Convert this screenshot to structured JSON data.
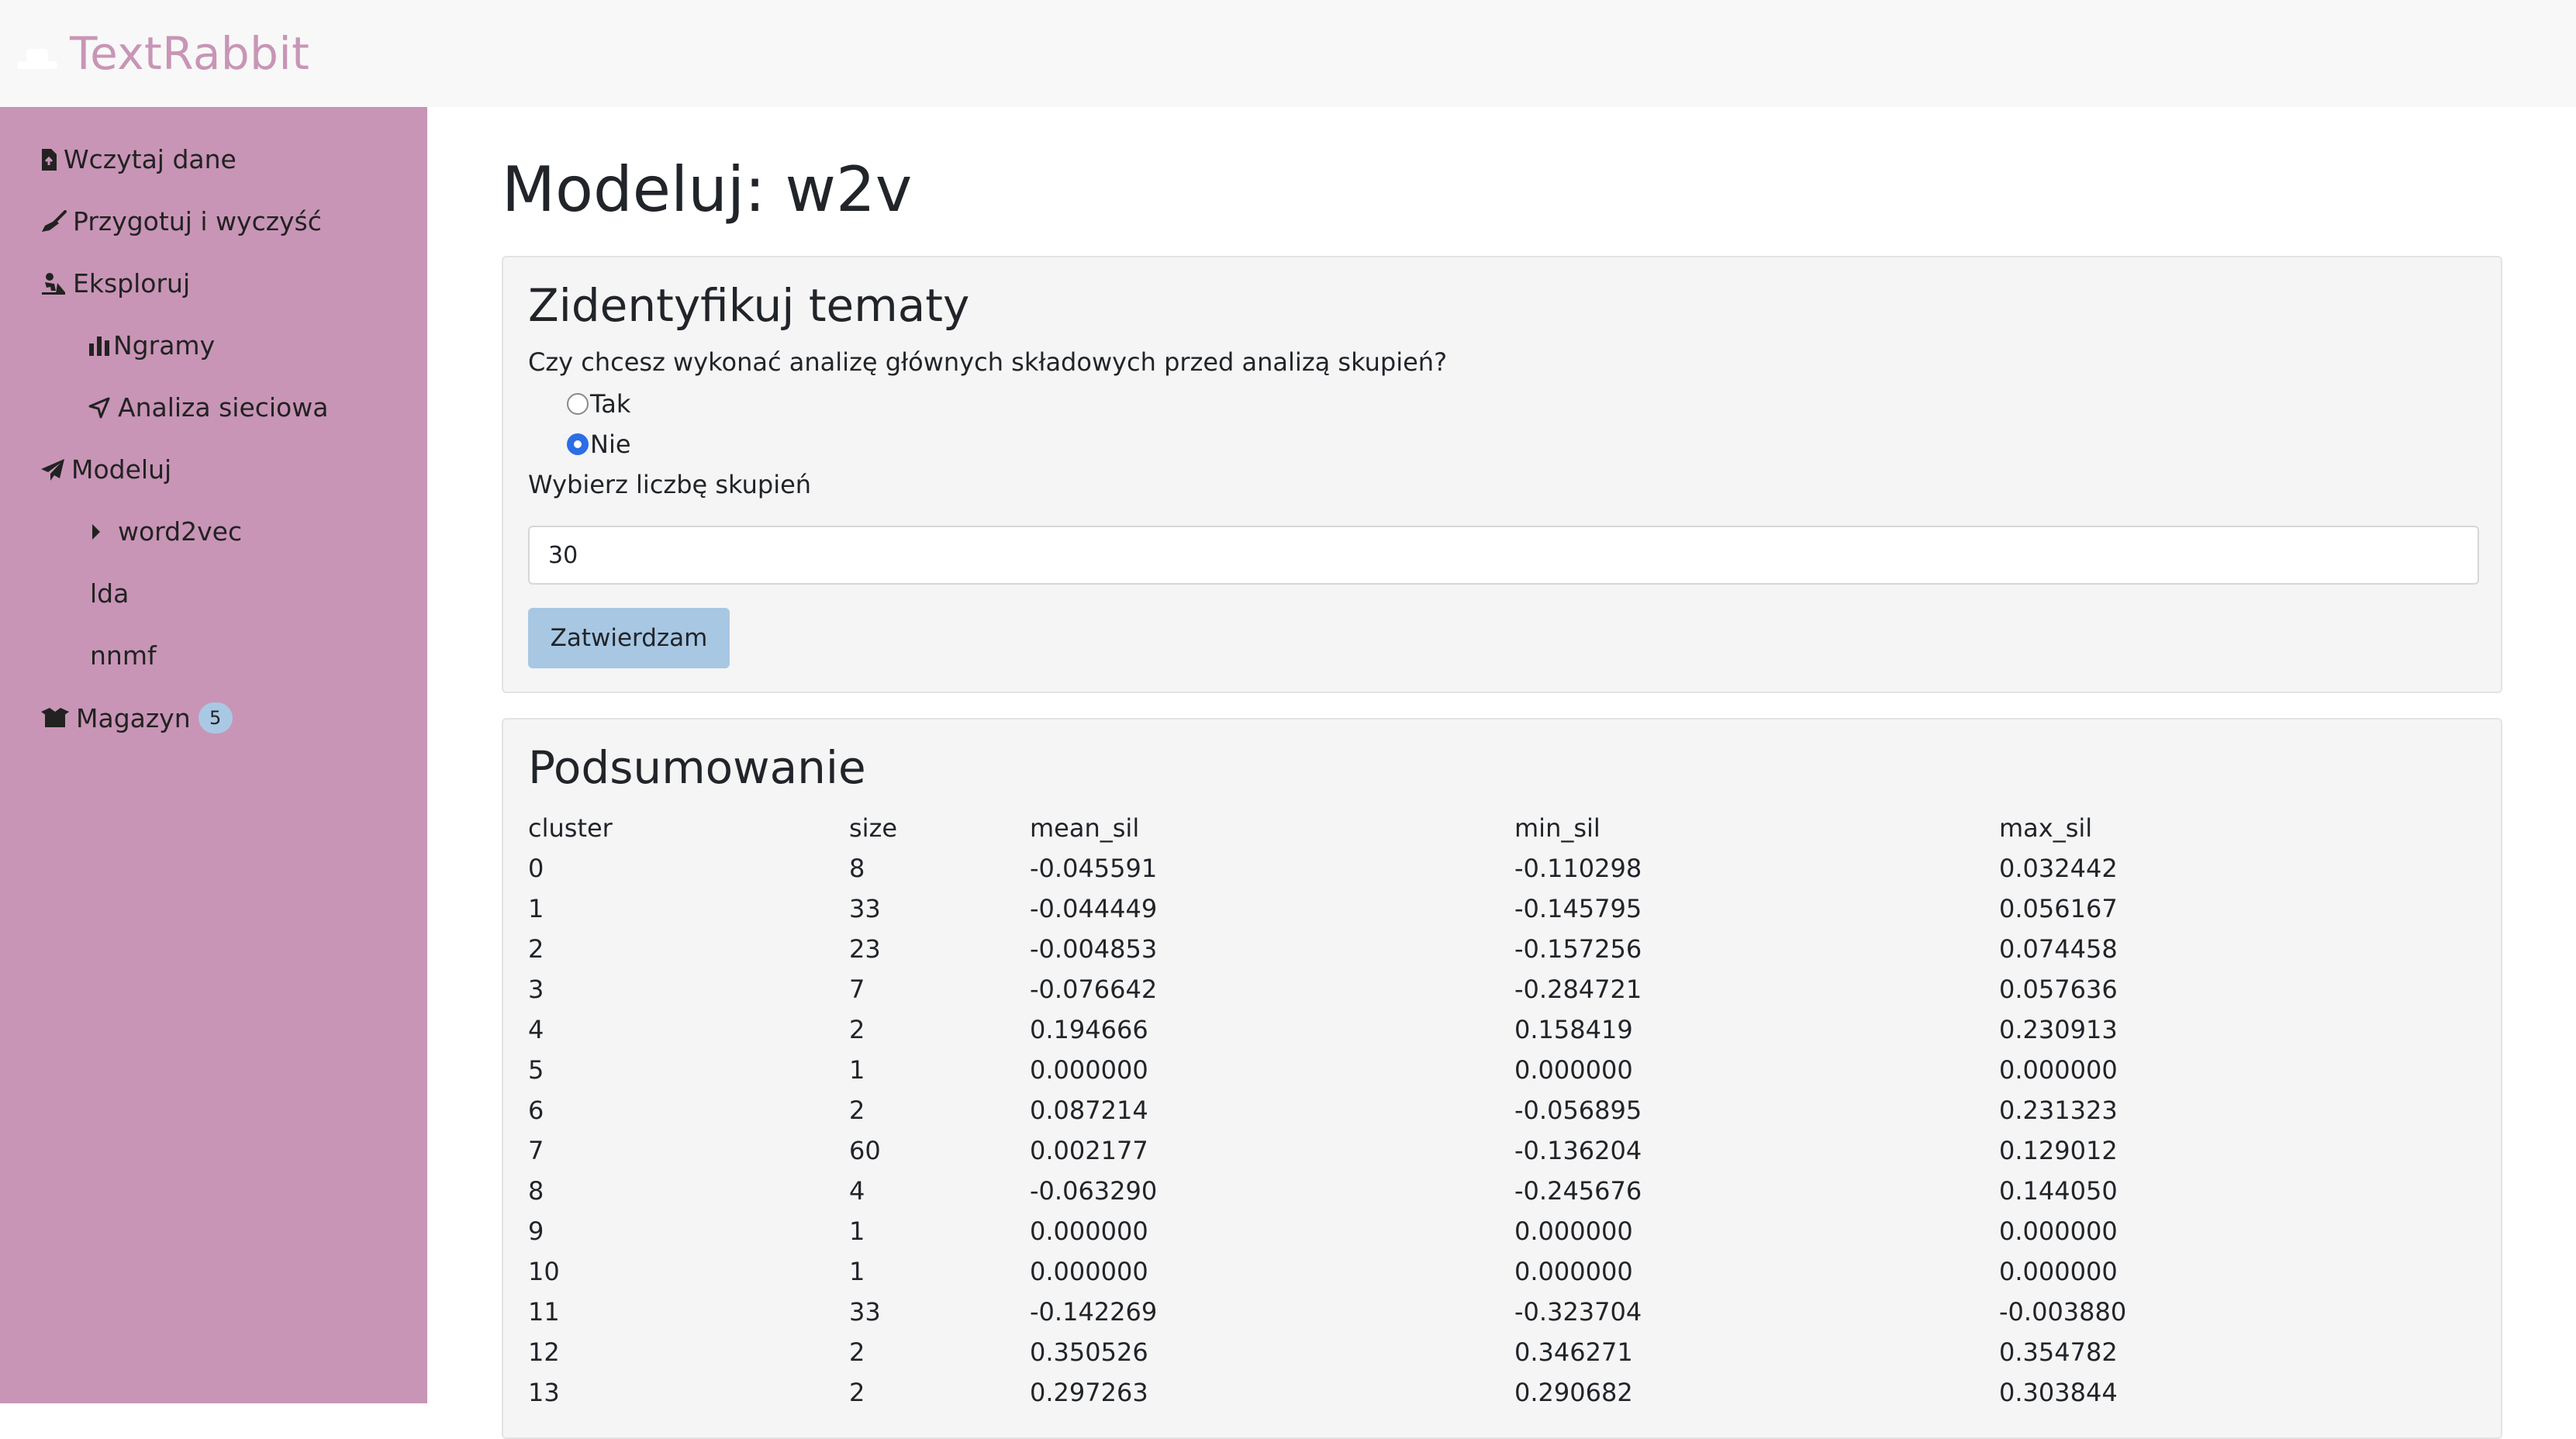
{
  "app": {
    "brand": "TextRabbit"
  },
  "sidebar": {
    "items": [
      {
        "label": "Wczytaj dane",
        "icon": "file-upload-icon"
      },
      {
        "label": "Przygotuj i wyczyść",
        "icon": "broom-icon"
      },
      {
        "label": "Eksploruj",
        "icon": "person-digging-icon"
      },
      {
        "label": "Ngramy",
        "icon": "bar-chart-icon"
      },
      {
        "label": "Analiza sieciowa",
        "icon": "location-arrow-icon"
      },
      {
        "label": "Modeluj",
        "icon": "paper-plane-icon"
      },
      {
        "label": "word2vec",
        "icon": "caret-right-icon"
      },
      {
        "label": "lda"
      },
      {
        "label": "nnmf"
      },
      {
        "label": "Magazyn",
        "icon": "box-open-icon",
        "badge": "5"
      }
    ]
  },
  "main": {
    "title": "Modeluj: w2v",
    "topics_card": {
      "heading": "Zidentyfikuj tematy",
      "question": "Czy chcesz wykonać analizę głównych składowych przed analizą skupień?",
      "options": [
        {
          "label": "Tak",
          "checked": false
        },
        {
          "label": "Nie",
          "checked": true
        }
      ],
      "clusters_label": "Wybierz liczbę skupień",
      "clusters_value": "30",
      "submit_label": "Zatwierdzam"
    },
    "summary_card": {
      "heading": "Podsumowanie",
      "columns": [
        "cluster",
        "size",
        "mean_sil",
        "min_sil",
        "max_sil"
      ],
      "rows": [
        [
          "0",
          "8",
          "-0.045591",
          "-0.110298",
          "0.032442"
        ],
        [
          "1",
          "33",
          "-0.044449",
          "-0.145795",
          "0.056167"
        ],
        [
          "2",
          "23",
          "-0.004853",
          "-0.157256",
          "0.074458"
        ],
        [
          "3",
          "7",
          "-0.076642",
          "-0.284721",
          "0.057636"
        ],
        [
          "4",
          "2",
          "0.194666",
          "0.158419",
          "0.230913"
        ],
        [
          "5",
          "1",
          "0.000000",
          "0.000000",
          "0.000000"
        ],
        [
          "6",
          "2",
          "0.087214",
          "-0.056895",
          "0.231323"
        ],
        [
          "7",
          "60",
          "0.002177",
          "-0.136204",
          "0.129012"
        ],
        [
          "8",
          "4",
          "-0.063290",
          "-0.245676",
          "0.144050"
        ],
        [
          "9",
          "1",
          "0.000000",
          "0.000000",
          "0.000000"
        ],
        [
          "10",
          "1",
          "0.000000",
          "0.000000",
          "0.000000"
        ],
        [
          "11",
          "33",
          "-0.142269",
          "-0.323704",
          "-0.003880"
        ],
        [
          "12",
          "2",
          "0.350526",
          "0.346271",
          "0.354782"
        ],
        [
          "13",
          "2",
          "0.297263",
          "0.290682",
          "0.303844"
        ]
      ]
    }
  },
  "colors": {
    "sidebar_bg": "#c895b6",
    "brand_text": "#c895b6",
    "topbar_bg": "#f8f8f8",
    "button_bg": "#a7c7e3",
    "badge_bg": "#a8c8e4",
    "radio_checked": "#2b6de6"
  }
}
